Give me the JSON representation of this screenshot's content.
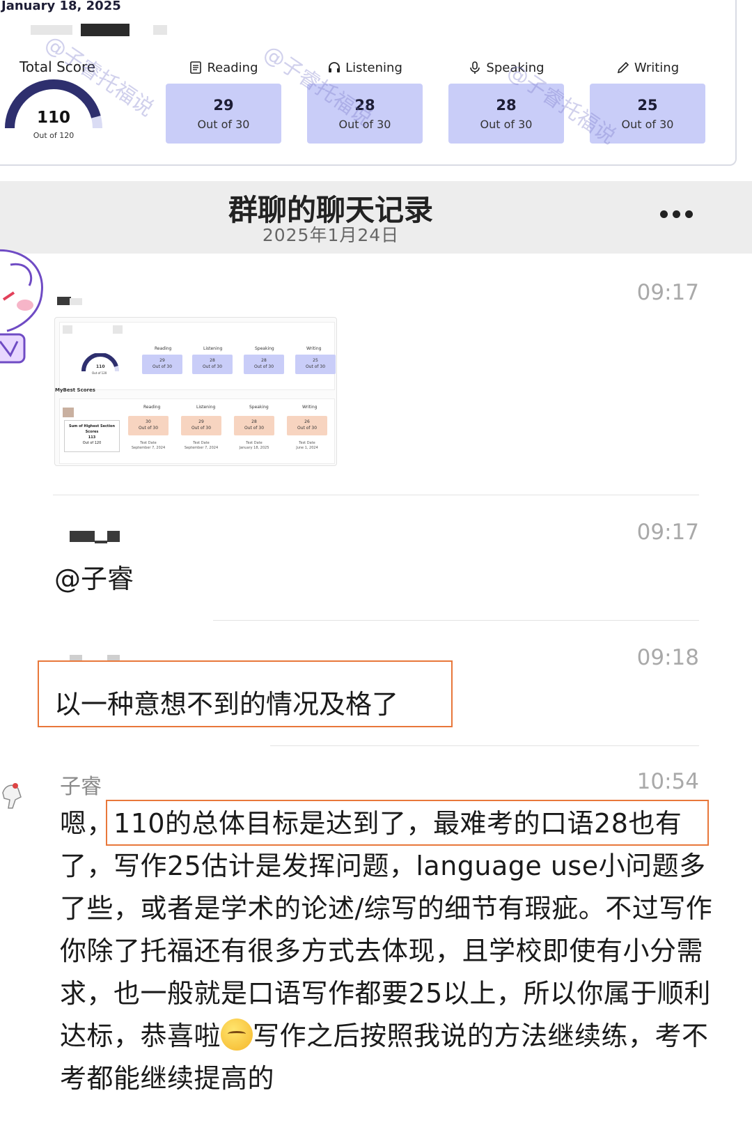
{
  "score_report": {
    "test_date": "January 18, 2025",
    "total": {
      "label": "Total Score",
      "value": "110",
      "out_of": "Out of 120",
      "fraction": 0.9167
    },
    "sections": [
      {
        "key": "reading",
        "label": "Reading",
        "icon": "book-icon",
        "score": "29",
        "out_of": "Out of 30"
      },
      {
        "key": "listening",
        "label": "Listening",
        "icon": "headphones-icon",
        "score": "28",
        "out_of": "Out of 30"
      },
      {
        "key": "speaking",
        "label": "Speaking",
        "icon": "microphone-icon",
        "score": "28",
        "out_of": "Out of 30"
      },
      {
        "key": "writing",
        "label": "Writing",
        "icon": "pencil-icon",
        "score": "25",
        "out_of": "Out of 30"
      }
    ],
    "watermark": "@子睿托福说"
  },
  "chat": {
    "title": "群聊的聊天记录",
    "date": "2025年1月24日",
    "messages": [
      {
        "time": "09:17",
        "type": "image"
      },
      {
        "time": "09:17",
        "text": "@子睿"
      },
      {
        "time": "09:18",
        "text": "以一种意想不到的情况及格了"
      },
      {
        "time": "10:54",
        "sender": "子睿",
        "text_pre": "嗯，",
        "text_highlight": "110的总体目标是达到了，最难考的口语28也",
        "text_after_1": "有了，写作25估计是发挥问题，language use小问题多了些，或者是学术的论述/综写的细节有瑕疵。不过写作你除了托福还有很多方式去体现，且学校即使有小分需求，也一般就是口语写作都要25以上，所以你属于顺利达标，恭喜啦",
        "text_after_2": "写作之后按照我说的方法继续练，考不考都能继续提高的"
      }
    ]
  },
  "thumbnail": {
    "top_sections": [
      {
        "label": "Reading",
        "score": "29",
        "out_of": "Out of 30"
      },
      {
        "label": "Listening",
        "score": "28",
        "out_of": "Out of 30"
      },
      {
        "label": "Speaking",
        "score": "28",
        "out_of": "Out of 30"
      },
      {
        "label": "Writing",
        "score": "25",
        "out_of": "Out of 30"
      }
    ],
    "total_value": "110",
    "total_out_of": "Out of 120",
    "best_label": "MyBest Scores",
    "best_sum_label": "Sum of Highest Section Scores",
    "best_sum_value": "113",
    "best_sum_out_of": "Out of 120",
    "best_sections": [
      {
        "label": "Reading",
        "score": "30",
        "out_of": "Out of 30",
        "date_label": "Test Date",
        "date": "September 7, 2024"
      },
      {
        "label": "Listening",
        "score": "29",
        "out_of": "Out of 30",
        "date_label": "Test Date",
        "date": "September 7, 2024"
      },
      {
        "label": "Speaking",
        "score": "28",
        "out_of": "Out of 30",
        "date_label": "Test Date",
        "date": "January 18, 2025"
      },
      {
        "label": "Writing",
        "score": "26",
        "out_of": "Out of 30",
        "date_label": "Test Date",
        "date": "June 1, 2024"
      }
    ]
  },
  "colors": {
    "section_fill": "#c9cdf8",
    "best_fill": "#f7d4c0",
    "gauge": "#2e2f6e",
    "highlight": "#e8773a",
    "header_bg": "#ededed"
  }
}
